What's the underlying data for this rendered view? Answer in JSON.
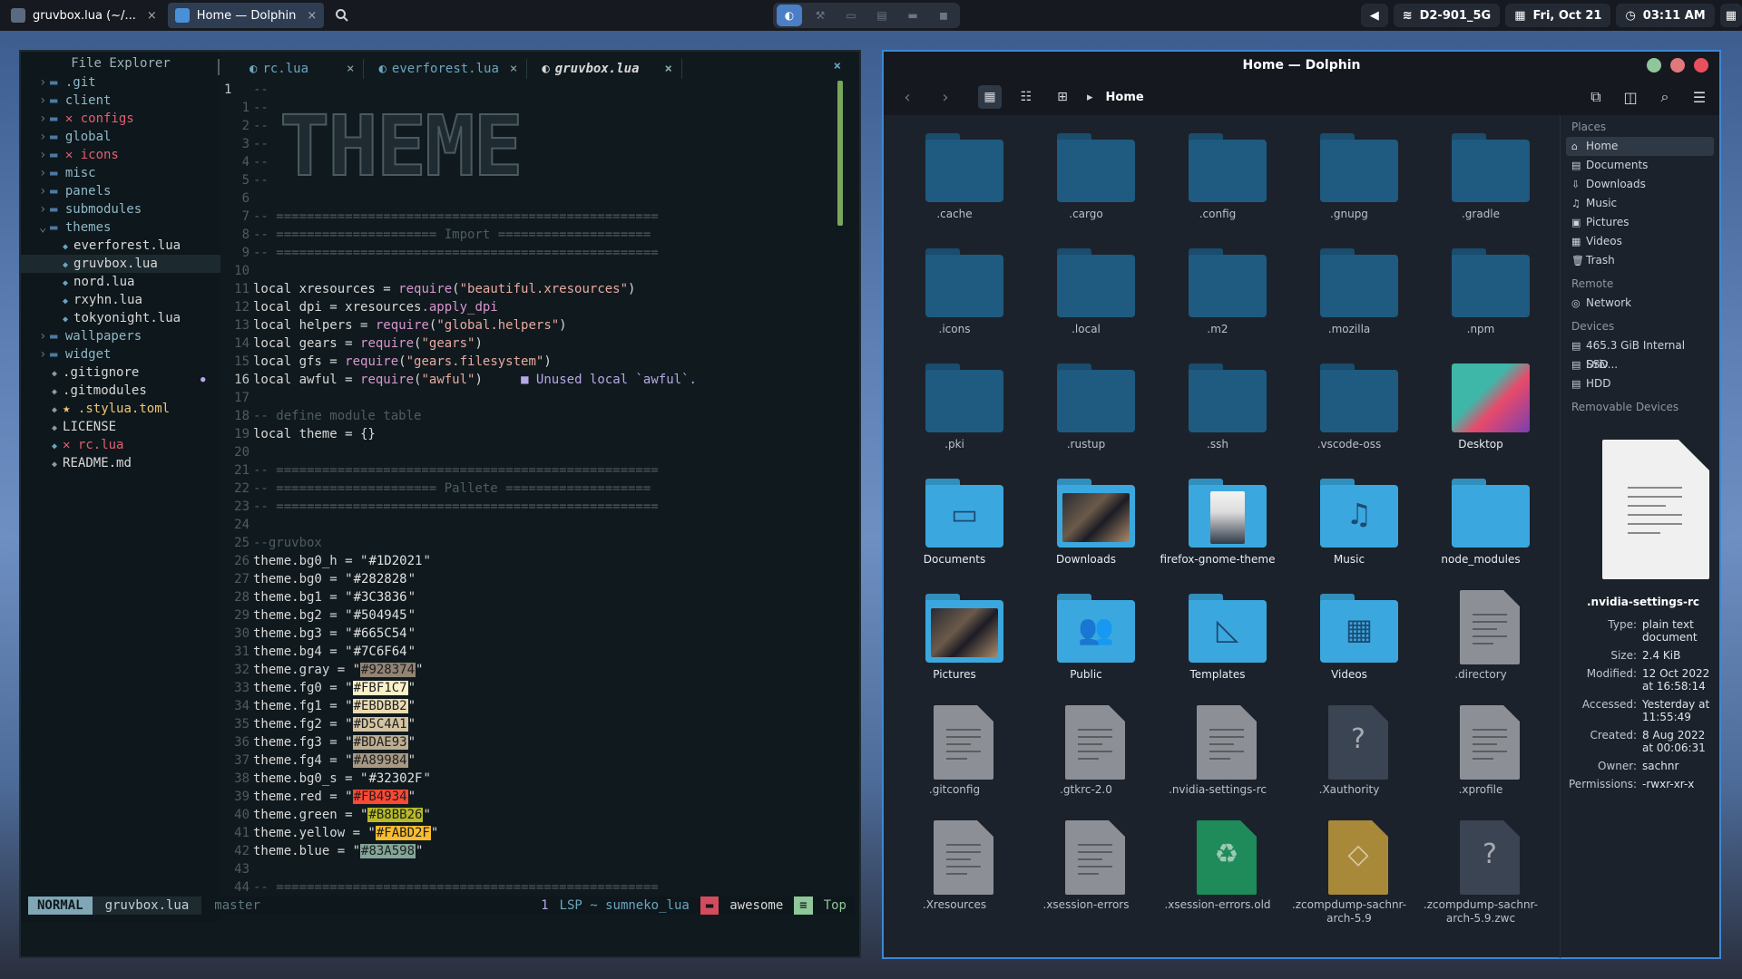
{
  "taskbar": {
    "tasks": [
      {
        "label": "gruvbox.lua (~/...",
        "close": "×"
      },
      {
        "label": "Home — Dolphin",
        "close": "×"
      }
    ],
    "network": "D2-901_5G",
    "date": "Fri, Oct 21",
    "time": "03:11 AM"
  },
  "editor": {
    "explorer_title": "File Explorer",
    "tree": [
      {
        "label": ".git",
        "type": "dir",
        "open": false,
        "mark": ""
      },
      {
        "label": "client",
        "type": "dir",
        "open": false,
        "mark": ""
      },
      {
        "label": "configs",
        "type": "dir",
        "open": false,
        "mark": "✕"
      },
      {
        "label": "global",
        "type": "dir",
        "open": false,
        "mark": ""
      },
      {
        "label": "icons",
        "type": "dir",
        "open": false,
        "mark": "✕"
      },
      {
        "label": "misc",
        "type": "dir",
        "open": false,
        "mark": ""
      },
      {
        "label": "panels",
        "type": "dir",
        "open": false,
        "mark": ""
      },
      {
        "label": "submodules",
        "type": "dir",
        "open": false,
        "mark": ""
      },
      {
        "label": "themes",
        "type": "dir",
        "open": true,
        "mark": ""
      },
      {
        "label": "everforest.lua",
        "type": "file",
        "indent": 2,
        "mark": ""
      },
      {
        "label": "gruvbox.lua",
        "type": "file",
        "indent": 2,
        "mark": ""
      },
      {
        "label": "nord.lua",
        "type": "file",
        "indent": 2,
        "mark": ""
      },
      {
        "label": "rxyhn.lua",
        "type": "file",
        "indent": 2,
        "mark": ""
      },
      {
        "label": "tokyonight.lua",
        "type": "file",
        "indent": 2,
        "mark": ""
      },
      {
        "label": "wallpapers",
        "type": "dir",
        "open": false,
        "mark": ""
      },
      {
        "label": "widget",
        "type": "dir",
        "open": false,
        "mark": ""
      },
      {
        "label": ".gitignore",
        "type": "file",
        "indent": 1,
        "mark": ""
      },
      {
        "label": ".gitmodules",
        "type": "file",
        "indent": 1,
        "mark": ""
      },
      {
        "label": ".stylua.toml",
        "type": "file",
        "indent": 1,
        "mark": "★"
      },
      {
        "label": "LICENSE",
        "type": "file",
        "indent": 1,
        "mark": ""
      },
      {
        "label": "rc.lua",
        "type": "file",
        "indent": 1,
        "mark": "✕"
      },
      {
        "label": "README.md",
        "type": "file",
        "indent": 1,
        "mark": ""
      }
    ],
    "tabs": [
      {
        "label": "rc.lua",
        "close": "×"
      },
      {
        "label": "everforest.lua",
        "close": "×"
      },
      {
        "label": "gruvbox.lua",
        "close": "×"
      }
    ],
    "window_close": "×",
    "banner": "THEME",
    "lines": [
      {
        "n": "1",
        "t": "--",
        "k": "com",
        "cur": true
      },
      {
        "n": "1",
        "t": "--",
        "k": "com"
      },
      {
        "n": "2",
        "t": "--",
        "k": "com"
      },
      {
        "n": "3",
        "t": "--",
        "k": "com"
      },
      {
        "n": "4",
        "t": "--",
        "k": "com"
      },
      {
        "n": "5",
        "t": "--",
        "k": "com"
      },
      {
        "n": "6",
        "t": "",
        "k": "com"
      },
      {
        "n": "7",
        "t": "-- ==================================================",
        "k": "com"
      },
      {
        "n": "8",
        "t": "-- ===================== Import ====================",
        "k": "com"
      },
      {
        "n": "9",
        "t": "-- ==================================================",
        "k": "com"
      },
      {
        "n": "10",
        "t": "",
        "k": "com"
      },
      {
        "n": "11",
        "t": "local xresources = require(\"beautiful.xresources\")",
        "k": "code"
      },
      {
        "n": "12",
        "t": "local dpi = xresources.apply_dpi",
        "k": "code"
      },
      {
        "n": "13",
        "t": "local helpers = require(\"global.helpers\")",
        "k": "code"
      },
      {
        "n": "14",
        "t": "local gears = require(\"gears\")",
        "k": "code"
      },
      {
        "n": "15",
        "t": "local gfs = require(\"gears.filesystem\")",
        "k": "code"
      },
      {
        "n": "16",
        "t": "local awful = require(\"awful\")",
        "k": "code",
        "hint": "■ Unused local `awful`.",
        "cur": true
      },
      {
        "n": "17",
        "t": "",
        "k": "com"
      },
      {
        "n": "18",
        "t": "-- define module table",
        "k": "com"
      },
      {
        "n": "19",
        "t": "local theme = {}",
        "k": "code"
      },
      {
        "n": "20",
        "t": "",
        "k": "com"
      },
      {
        "n": "21",
        "t": "-- ==================================================",
        "k": "com"
      },
      {
        "n": "22",
        "t": "-- ===================== Pallete ===================",
        "k": "com"
      },
      {
        "n": "23",
        "t": "-- ==================================================",
        "k": "com"
      },
      {
        "n": "24",
        "t": "",
        "k": "com"
      },
      {
        "n": "25",
        "t": "--gruvbox",
        "k": "com"
      },
      {
        "n": "26",
        "t": "theme.bg0_h = \"",
        "hex": "#1D2021",
        "bg": "",
        "k": "hex"
      },
      {
        "n": "27",
        "t": "theme.bg0 = \"",
        "hex": "#282828",
        "bg": "",
        "k": "hex"
      },
      {
        "n": "28",
        "t": "theme.bg1 = \"",
        "hex": "#3C3836",
        "bg": "",
        "k": "hex"
      },
      {
        "n": "29",
        "t": "theme.bg2 = \"",
        "hex": "#504945",
        "bg": "",
        "k": "hex"
      },
      {
        "n": "30",
        "t": "theme.bg3 = \"",
        "hex": "#665C54",
        "bg": "",
        "k": "hex"
      },
      {
        "n": "31",
        "t": "theme.bg4 = \"",
        "hex": "#7C6F64",
        "bg": "",
        "k": "hex"
      },
      {
        "n": "32",
        "t": "theme.gray = \"",
        "hex": "#928374",
        "bg": "#928374",
        "k": "hex"
      },
      {
        "n": "33",
        "t": "theme.fg0 = \"",
        "hex": "#FBF1C7",
        "bg": "#FBF1C7",
        "k": "hex"
      },
      {
        "n": "34",
        "t": "theme.fg1 = \"",
        "hex": "#EBDBB2",
        "bg": "#EBDBB2",
        "k": "hex"
      },
      {
        "n": "35",
        "t": "theme.fg2 = \"",
        "hex": "#D5C4A1",
        "bg": "#D5C4A1",
        "k": "hex"
      },
      {
        "n": "36",
        "t": "theme.fg3 = \"",
        "hex": "#BDAE93",
        "bg": "#BDAE93",
        "k": "hex"
      },
      {
        "n": "37",
        "t": "theme.fg4 = \"",
        "hex": "#A89984",
        "bg": "#A89984",
        "k": "hex"
      },
      {
        "n": "38",
        "t": "theme.bg0_s = \"",
        "hex": "#32302F",
        "bg": "",
        "k": "hex"
      },
      {
        "n": "39",
        "t": "theme.red = \"",
        "hex": "#FB4934",
        "bg": "#FB4934",
        "k": "hex"
      },
      {
        "n": "40",
        "t": "theme.green = \"",
        "hex": "#B8BB26",
        "bg": "#B8BB26",
        "k": "hex"
      },
      {
        "n": "41",
        "t": "theme.yellow = \"",
        "hex": "#FABD2F",
        "bg": "#FABD2F",
        "k": "hex"
      },
      {
        "n": "42",
        "t": "theme.blue = \"",
        "hex": "#83A598",
        "bg": "#83A598",
        "k": "hex"
      },
      {
        "n": "43",
        "t": "",
        "k": "com"
      },
      {
        "n": "44",
        "t": "-- ==================================================",
        "k": "com"
      }
    ],
    "status": {
      "mode": "NORMAL",
      "file": "gruvbox.lua",
      "branch": "master",
      "diag": "1",
      "lsp": "LSP ~ sumneko_lua",
      "project": "awesome",
      "position": "Top"
    }
  },
  "dolphin": {
    "title": "Home — Dolphin",
    "crumb": "Home",
    "items": [
      {
        "label": ".cache",
        "kind": "dfolder"
      },
      {
        "label": ".cargo",
        "kind": "dfolder"
      },
      {
        "label": ".config",
        "kind": "dfolder"
      },
      {
        "label": ".gnupg",
        "kind": "dfolder"
      },
      {
        "label": ".gradle",
        "kind": "dfolder"
      },
      {
        "label": ".icons",
        "kind": "dfolder"
      },
      {
        "label": ".local",
        "kind": "dfolder"
      },
      {
        "label": ".m2",
        "kind": "dfolder"
      },
      {
        "label": ".mozilla",
        "kind": "dfolder"
      },
      {
        "label": ".npm",
        "kind": "dfolder"
      },
      {
        "label": ".pki",
        "kind": "dfolder"
      },
      {
        "label": ".rustup",
        "kind": "dfolder"
      },
      {
        "label": ".ssh",
        "kind": "dfolder"
      },
      {
        "label": ".vscode-oss",
        "kind": "dfolder"
      },
      {
        "label": "Desktop",
        "kind": "desktop"
      },
      {
        "label": "Documents",
        "kind": "folder",
        "glyph": "▭"
      },
      {
        "label": "Downloads",
        "kind": "thumb"
      },
      {
        "label": "firefox-gnome-theme",
        "kind": "thumb2"
      },
      {
        "label": "Music",
        "kind": "folder",
        "glyph": "♫"
      },
      {
        "label": "node_modules",
        "kind": "folder",
        "glyph": ""
      },
      {
        "label": "Pictures",
        "kind": "thumb3"
      },
      {
        "label": "Public",
        "kind": "folder",
        "glyph": "👥"
      },
      {
        "label": "Templates",
        "kind": "folder",
        "glyph": "◺"
      },
      {
        "label": "Videos",
        "kind": "folder",
        "glyph": "▦"
      },
      {
        "label": ".directory",
        "kind": "doc"
      },
      {
        "label": ".gitconfig",
        "kind": "doc"
      },
      {
        "label": ".gtkrc-2.0",
        "kind": "doc"
      },
      {
        "label": ".nvidia-settings-rc",
        "kind": "doc"
      },
      {
        "label": ".Xauthority",
        "kind": "ddoc"
      },
      {
        "label": ".xprofile",
        "kind": "doc"
      },
      {
        "label": ".Xresources",
        "kind": "doc"
      },
      {
        "label": ".xsession-errors",
        "kind": "doc"
      },
      {
        "label": ".xsession-errors.old",
        "kind": "gdoc"
      },
      {
        "label": ".zcompdump-sachnr-arch-5.9",
        "kind": "ydoc"
      },
      {
        "label": ".zcompdump-sachnr-arch-5.9.zwc",
        "kind": "ddoc"
      }
    ],
    "places_title": "Places",
    "places": [
      {
        "label": "Home",
        "icon": "⌂",
        "sel": true
      },
      {
        "label": "Documents",
        "icon": "▤"
      },
      {
        "label": "Downloads",
        "icon": "⇩"
      },
      {
        "label": "Music",
        "icon": "♫"
      },
      {
        "label": "Pictures",
        "icon": "▣"
      },
      {
        "label": "Videos",
        "icon": "▦"
      },
      {
        "label": "Trash",
        "icon": "🗑"
      }
    ],
    "remote_title": "Remote",
    "remote": [
      {
        "label": "Network",
        "icon": "◎"
      }
    ],
    "devices_title": "Devices",
    "devices": [
      {
        "label": "465.3 GiB Internal Driv...",
        "icon": "▤"
      },
      {
        "label": "SSD",
        "icon": "▤"
      },
      {
        "label": "HDD",
        "icon": "▤"
      }
    ],
    "removable_title": "Removable Devices",
    "info": {
      "name": ".nvidia-settings-rc",
      "rows": [
        {
          "k": "Type:",
          "v": "plain text document"
        },
        {
          "k": "Size:",
          "v": "2.4 KiB"
        },
        {
          "k": "Modified:",
          "v": "12 Oct 2022 at 16:58:14"
        },
        {
          "k": "Accessed:",
          "v": "Yesterday at 11:55:49"
        },
        {
          "k": "Created:",
          "v": "8 Aug 2022 at 00:06:31"
        },
        {
          "k": "Owner:",
          "v": "sachnr"
        },
        {
          "k": "Permissions:",
          "v": "-rwxr-xr-x"
        }
      ]
    }
  },
  "colors": {
    "dark_folder": "#1f5a80",
    "bright_folder": "#3aa8de",
    "doc_gray": "#8c9096",
    "accent": "#3d87d6"
  }
}
